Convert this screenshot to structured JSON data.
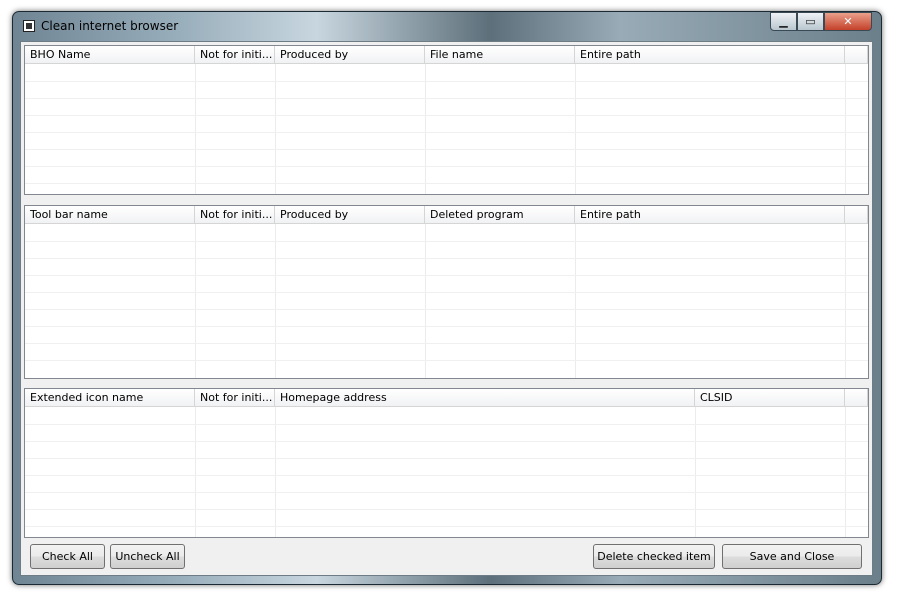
{
  "window": {
    "title": "Clean internet browser",
    "min_glyph": "▁",
    "max_glyph": "▭",
    "close_glyph": "✕"
  },
  "bho_list": {
    "columns": [
      "BHO Name",
      "Not for initi...",
      "Produced by",
      "File name",
      "Entire path"
    ]
  },
  "toolbar_list": {
    "columns": [
      "Tool bar name",
      "Not for initi...",
      "Produced by",
      "Deleted program",
      "Entire path"
    ]
  },
  "icon_list": {
    "columns": [
      "Extended icon name",
      "Not for initi...",
      "Homepage address",
      "CLSID"
    ]
  },
  "buttons": {
    "check_all": "Check All",
    "uncheck_all": "Uncheck All",
    "delete_checked": "Delete checked item",
    "save_close": "Save and Close"
  }
}
